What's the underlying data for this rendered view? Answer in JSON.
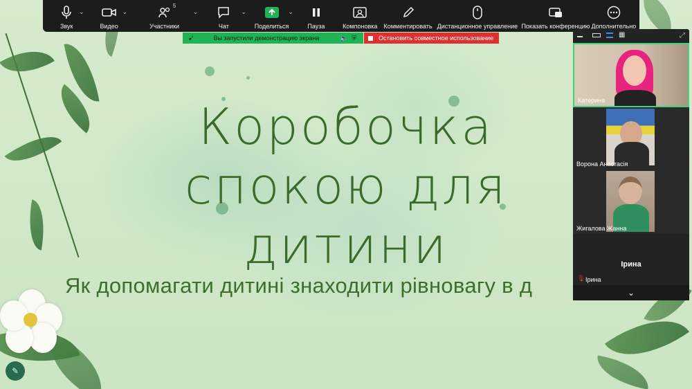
{
  "toolbar": {
    "items": [
      {
        "label": "Звук",
        "icon": "microphone-icon"
      },
      {
        "label": "Видео",
        "icon": "video-camera-icon"
      },
      {
        "label": "Участники",
        "icon": "participants-icon",
        "count": "5"
      },
      {
        "label": "Чат",
        "icon": "chat-icon"
      },
      {
        "label": "Поделиться",
        "icon": "share-screen-icon"
      },
      {
        "label": "Пауза",
        "icon": "pause-icon"
      },
      {
        "label": "Компоновка",
        "icon": "layout-icon"
      },
      {
        "label": "Комментировать",
        "icon": "annotate-pen-icon"
      },
      {
        "label": "Дистанционное управление",
        "icon": "mouse-icon"
      },
      {
        "label": "Показать конференцию",
        "icon": "show-meeting-icon"
      },
      {
        "label": "Дополнительно",
        "icon": "more-icon"
      }
    ]
  },
  "share_status": {
    "sharing_text": "Вы запустили демонстрацию экрана",
    "stop_text": "Остановить совместное использование"
  },
  "slide": {
    "title_lines": [
      "Коробочка",
      "спокою для",
      "дитини"
    ],
    "subtitle": "Як допомагати дитині знаходити рівновагу в д"
  },
  "participants": [
    {
      "name": "Катерина"
    },
    {
      "name": "Ворона Анастасія"
    },
    {
      "name": "Жигалова Жанна"
    },
    {
      "name": "Ірина",
      "display_name": "Ірина",
      "muted": true
    }
  ],
  "colors": {
    "toolbar_bg": "#1c1c1c",
    "share_green": "#1fb355",
    "share_red": "#e0302e",
    "active_speaker_border": "#3fd27a",
    "title_green": "#3a6b2a"
  }
}
